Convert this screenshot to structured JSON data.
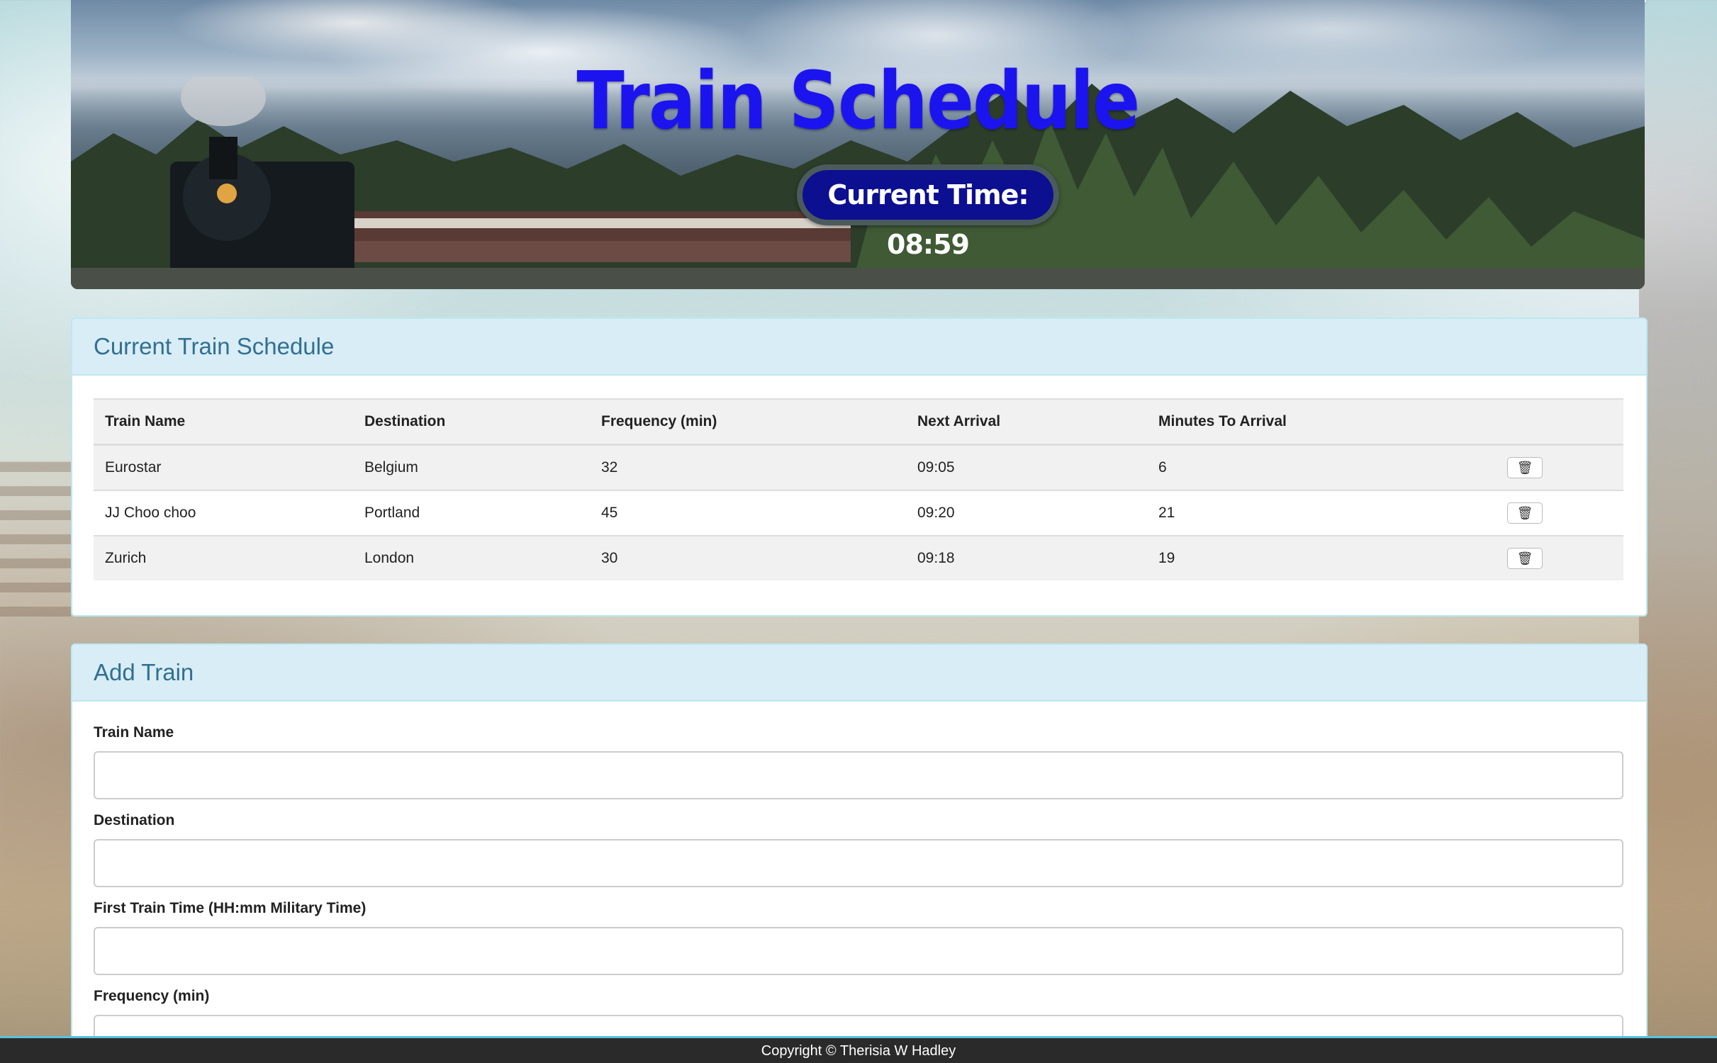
{
  "header": {
    "title": "Train Schedule",
    "current_time_label": "Current Time: 08:59"
  },
  "schedule": {
    "heading": "Current Train Schedule",
    "columns": [
      "Train Name",
      "Destination",
      "Frequency (min)",
      "Next Arrival",
      "Minutes To Arrival"
    ],
    "rows": [
      {
        "name": "Eurostar",
        "destination": "Belgium",
        "frequency": "32",
        "next_arrival": "09:05",
        "minutes_to_arrival": "6"
      },
      {
        "name": "JJ Choo choo",
        "destination": "Portland",
        "frequency": "45",
        "next_arrival": "09:20",
        "minutes_to_arrival": "21"
      },
      {
        "name": "Zurich",
        "destination": "London",
        "frequency": "30",
        "next_arrival": "09:18",
        "minutes_to_arrival": "19"
      }
    ],
    "delete_icon": "trash-icon"
  },
  "add_train": {
    "heading": "Add Train",
    "fields": [
      {
        "label": "Train Name",
        "value": ""
      },
      {
        "label": "Destination",
        "value": ""
      },
      {
        "label": "First Train Time (HH:mm Military Time)",
        "value": ""
      },
      {
        "label": "Frequency (min)",
        "value": ""
      }
    ]
  },
  "footer": {
    "text": "Copyright © Therisia W Hadley"
  },
  "colors": {
    "title": "#1c14ee",
    "clock_bg": "#0c0f8f",
    "panel_heading_bg": "#d9edf7",
    "panel_heading_text": "#31708f",
    "footer_bg": "#2a2a2a"
  }
}
